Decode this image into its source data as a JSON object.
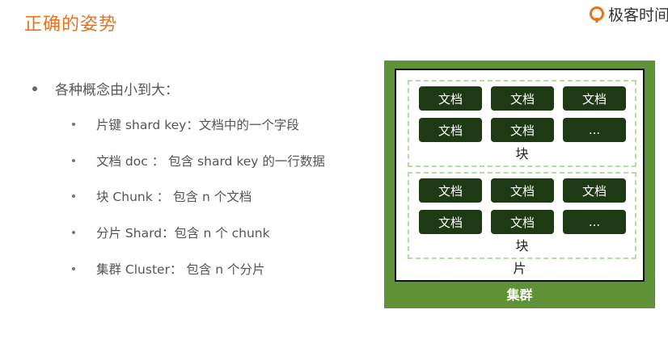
{
  "page_title": "正确的姿势",
  "logo": {
    "text": "极客时间",
    "icon": "geektime-logo-icon",
    "color": "#e8711c"
  },
  "main_bullet": "各种概念由小到大：",
  "sub_items": [
    "片键 shard key：文档中的一个字段",
    "文档 doc ： 包含 shard key 的一行数据",
    "块 Chunk ： 包含 n 个文档",
    "分片 Shard：包含 n 个 chunk",
    "集群 Cluster： 包含 n 个分片"
  ],
  "diagram": {
    "cluster_label": "集群",
    "shard_label": "片",
    "chunks": [
      {
        "label": "块",
        "docs": [
          "文档",
          "文档",
          "文档",
          "文档",
          "文档",
          "..."
        ]
      },
      {
        "label": "块",
        "docs": [
          "文档",
          "文档",
          "文档",
          "文档",
          "文档",
          "..."
        ]
      }
    ],
    "colors": {
      "cluster": "#5f9236",
      "doc": "#1e3a14",
      "chunk_border": "#b8d9a8"
    }
  }
}
